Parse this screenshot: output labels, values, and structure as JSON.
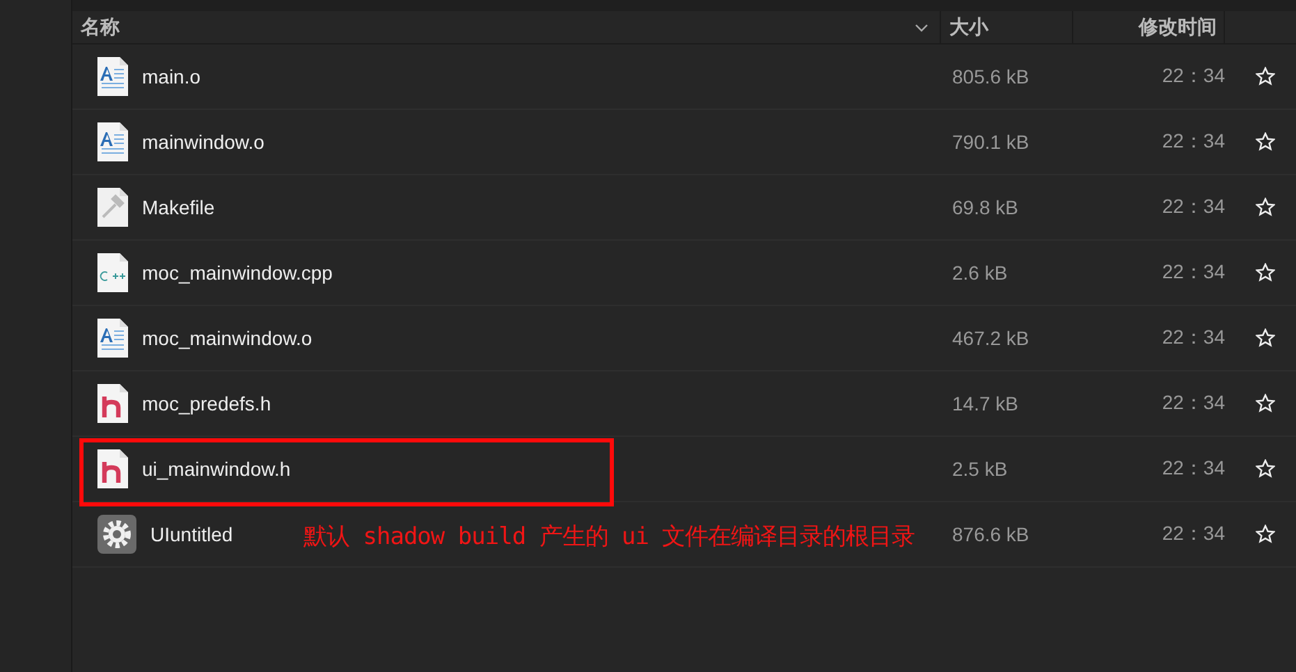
{
  "columns": {
    "name": "名称",
    "size": "大小",
    "modified": "修改时间"
  },
  "rows": [
    {
      "name": "main.o",
      "kind": "object",
      "size": "805.6 kB",
      "modified": "22：34",
      "highlighted": false
    },
    {
      "name": "mainwindow.o",
      "kind": "object",
      "size": "790.1 kB",
      "modified": "22：34",
      "highlighted": false
    },
    {
      "name": "Makefile",
      "kind": "makefile",
      "size": "69.8 kB",
      "modified": "22：34",
      "highlighted": false
    },
    {
      "name": "moc_mainwindow.cpp",
      "kind": "cpp",
      "size": "2.6 kB",
      "modified": "22：34",
      "highlighted": false
    },
    {
      "name": "moc_mainwindow.o",
      "kind": "object",
      "size": "467.2 kB",
      "modified": "22：34",
      "highlighted": false
    },
    {
      "name": "moc_predefs.h",
      "kind": "header",
      "size": "14.7 kB",
      "modified": "22：34",
      "highlighted": false
    },
    {
      "name": "ui_mainwindow.h",
      "kind": "header",
      "size": "2.5 kB",
      "modified": "22：34",
      "highlighted": true
    },
    {
      "name": "UIuntitled",
      "kind": "executable",
      "size": "876.6 kB",
      "modified": "22：34",
      "highlighted": false
    }
  ],
  "annotation": {
    "text": "默认 shadow build 产生的 ui 文件在编译目录的根目录"
  }
}
